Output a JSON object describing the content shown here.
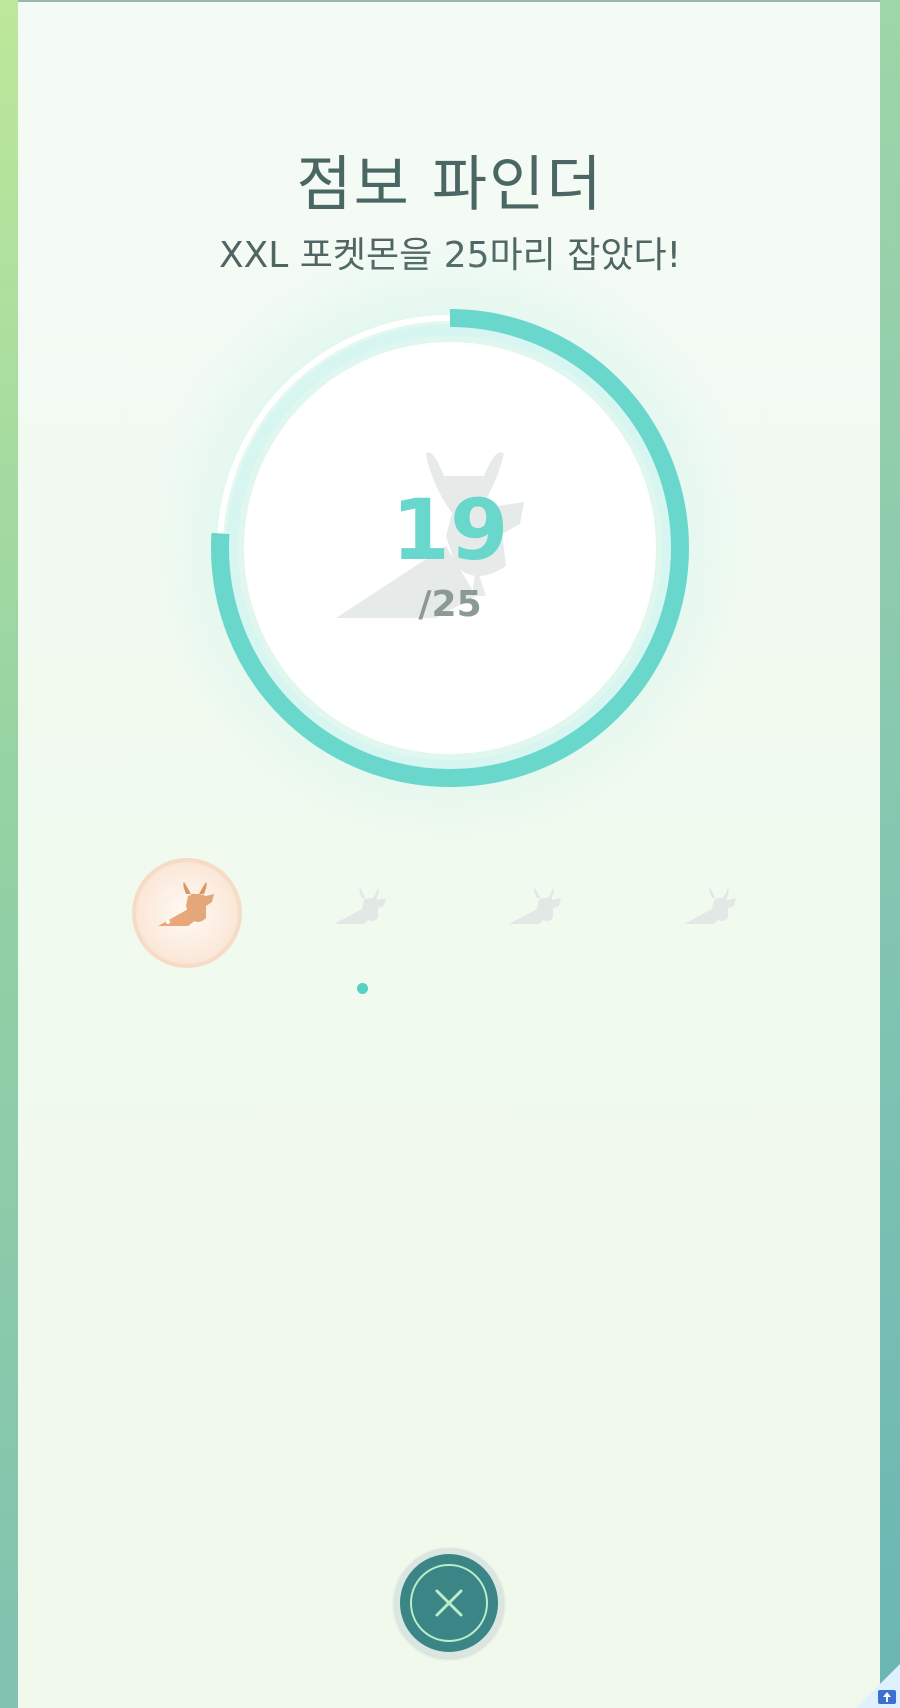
{
  "medal": {
    "title": "점보 파인더",
    "subtitle": "XXL 포켓몬을 25마리 잡았다!",
    "progress": {
      "current": "19",
      "total_label": "/25",
      "fraction": 0.76
    },
    "tiers": [
      {
        "tier": "bronze",
        "unlocked": true,
        "icon": "pikachu-silhouette-icon"
      },
      {
        "tier": "silver",
        "unlocked": false,
        "icon": "pikachu-silhouette-icon"
      },
      {
        "tier": "gold",
        "unlocked": false,
        "icon": "pikachu-silhouette-icon"
      },
      {
        "tier": "platinum",
        "unlocked": false,
        "icon": "pikachu-silhouette-icon"
      }
    ],
    "selected_tier_index": 1
  },
  "colors": {
    "accent": "#6ad7cd",
    "ring_track": "#d6f6f1",
    "text": "#4b6764",
    "close_button": "#3b8586",
    "bronze": "#e3a77a"
  },
  "close_button": {
    "icon": "close-icon"
  }
}
